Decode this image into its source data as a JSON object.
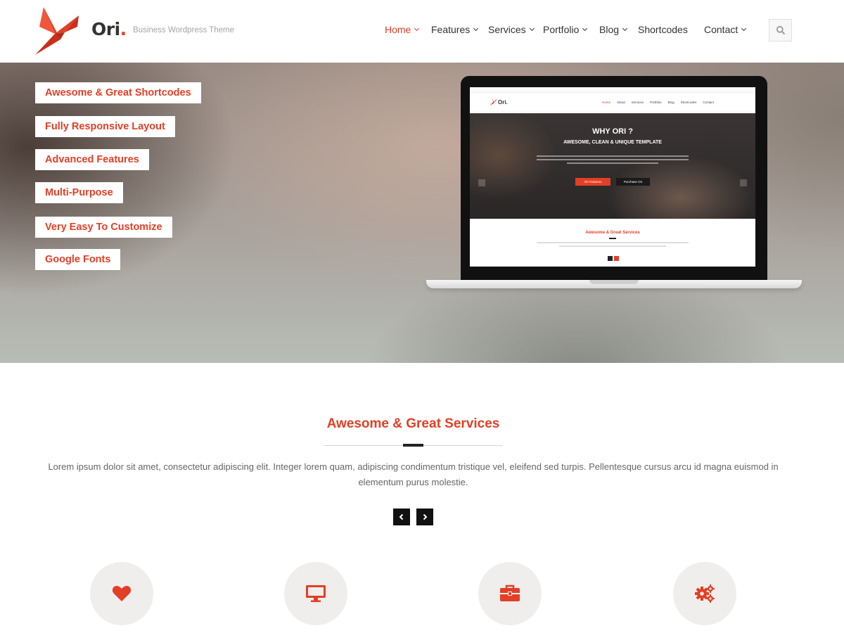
{
  "header": {
    "logo_text": "Ori",
    "logo_dot": ".",
    "tagline": "Business Wordpress Theme",
    "nav": [
      {
        "label": "Home",
        "active": true,
        "dropdown": true
      },
      {
        "label": "Features",
        "active": false,
        "dropdown": true
      },
      {
        "label": "Services",
        "active": false,
        "dropdown": true
      },
      {
        "label": "Portfolio",
        "active": false,
        "dropdown": true
      },
      {
        "label": "Blog",
        "active": false,
        "dropdown": true
      },
      {
        "label": "Shortcodes",
        "active": false,
        "dropdown": false
      },
      {
        "label": "Contact",
        "active": false,
        "dropdown": true
      }
    ],
    "search_icon": "search-icon"
  },
  "hero": {
    "features": [
      "Awesome & Great Shortcodes",
      "Fully Responsive Layout",
      "Advanced Features",
      "Multi-Purpose",
      "Very Easy To Customize",
      "Google Fonts"
    ],
    "screen": {
      "logo": "Ori.",
      "nav": [
        "Home",
        "About",
        "Services",
        "Portfolio",
        "Blog",
        "Shortcodes",
        "Contact"
      ],
      "headline": "WHY ORI ?",
      "subheadline": "AWESOME, CLEAN & UNIQUE TEMPLATE",
      "btn_primary": "Ori Features",
      "btn_secondary": "Purchase Ori",
      "services_title": "Awesome & Great Services"
    }
  },
  "services": {
    "title": "Awesome & Great Services",
    "description": "Lorem ipsum dolor sit amet, consectetur adipiscing elit. Integer lorem quam, adipiscing condimentum tristique vel, eleifend sed turpis. Pellentesque cursus arcu id magna euismod in elementum purus molestie.",
    "icons": [
      "heart-icon",
      "desktop-icon",
      "briefcase-icon",
      "gears-icon"
    ]
  },
  "colors": {
    "accent": "#e23f26",
    "dark": "#111111",
    "circle_bg": "#efeeec"
  }
}
